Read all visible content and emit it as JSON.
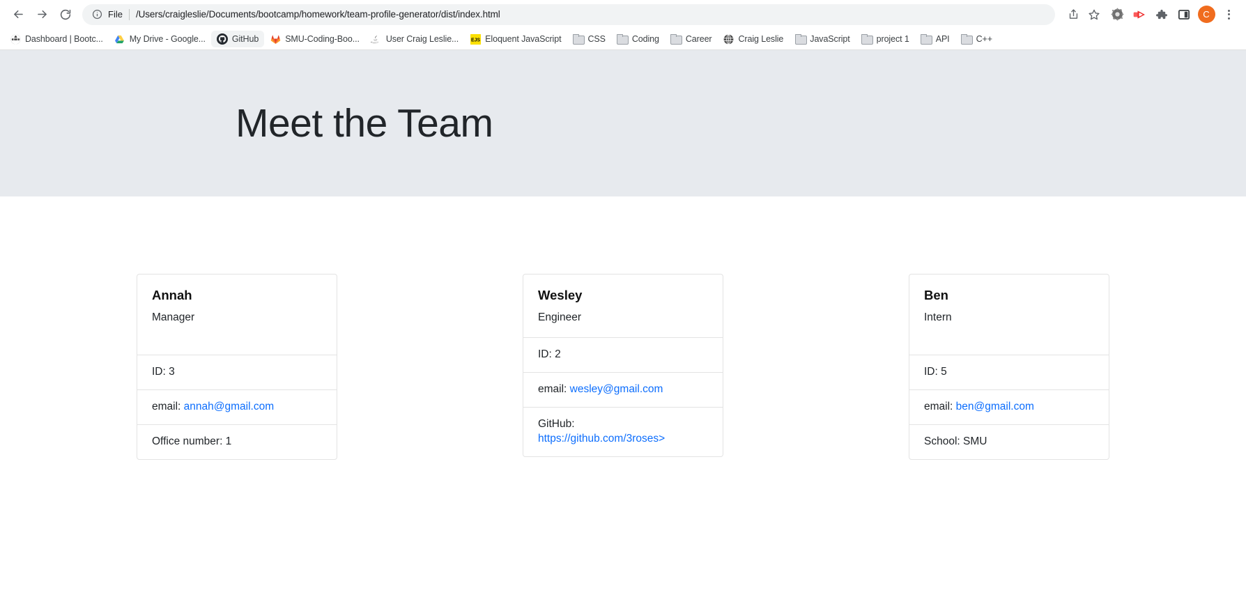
{
  "browser": {
    "nav": {
      "back_icon": "arrow-left-icon",
      "forward_icon": "arrow-right-icon",
      "reload_icon": "reload-icon"
    },
    "omnibox": {
      "info_icon": "info-circle-icon",
      "scheme_label": "File",
      "url": "/Users/craigleslie/Documents/bootcamp/homework/team-profile-generator/dist/index.html",
      "share_icon": "share-icon",
      "bookmark_icon": "star-icon"
    },
    "toolbar_right": [
      {
        "name": "honey-extension-icon",
        "label": ""
      },
      {
        "name": "red-play-extension-icon",
        "label": ""
      },
      {
        "name": "extensions-puzzle-icon",
        "label": ""
      },
      {
        "name": "side-panel-icon",
        "label": ""
      }
    ],
    "profile": {
      "avatar_initial": "C",
      "avatar_color": "#f06c1e"
    },
    "menu_icon": "three-dot-menu-icon"
  },
  "bookmarks": [
    {
      "label": "Dashboard | Bootc...",
      "icon": "globe-icon",
      "active": false
    },
    {
      "label": "My Drive - Google...",
      "icon": "google-drive-icon",
      "active": false
    },
    {
      "label": "GitHub",
      "icon": "github-icon",
      "active": true
    },
    {
      "label": "SMU-Coding-Boo...",
      "icon": "gitlab-icon",
      "active": false
    },
    {
      "label": "User Craig Leslie...",
      "icon": "java-icon",
      "active": false
    },
    {
      "label": "Eloquent JavaScript",
      "icon": "ejs-icon",
      "active": false
    },
    {
      "label": "CSS",
      "icon": "folder-icon",
      "active": false
    },
    {
      "label": "Coding",
      "icon": "folder-icon",
      "active": false
    },
    {
      "label": "Career",
      "icon": "folder-icon",
      "active": false
    },
    {
      "label": "Craig Leslie",
      "icon": "globe-icon",
      "active": false
    },
    {
      "label": "JavaScript",
      "icon": "folder-icon",
      "active": false
    },
    {
      "label": "project 1",
      "icon": "folder-icon",
      "active": false
    },
    {
      "label": "API",
      "icon": "folder-icon",
      "active": false
    },
    {
      "label": "C++",
      "icon": "folder-icon",
      "active": false
    }
  ],
  "hero": {
    "title": "Meet the Team",
    "background_color": "#e7eaee"
  },
  "cards": [
    {
      "name": "Annah",
      "role": "Manager",
      "id_label": "ID: 3",
      "email_label": "email:",
      "email": "annah@gmail.com",
      "extra_label": "Office number: 1",
      "extra_link": null,
      "extra_prefix": null
    },
    {
      "name": "Wesley",
      "role": "Engineer",
      "id_label": "ID: 2",
      "email_label": "email:",
      "email": "wesley@gmail.com",
      "extra_label": null,
      "extra_prefix": "GitHub:",
      "extra_link": "https://github.com/3roses>"
    },
    {
      "name": "Ben",
      "role": "Intern",
      "id_label": "ID: 5",
      "email_label": "email:",
      "email": "ben@gmail.com",
      "extra_label": "School: SMU",
      "extra_link": null,
      "extra_prefix": null
    }
  ],
  "link_color": "#0d6efd"
}
